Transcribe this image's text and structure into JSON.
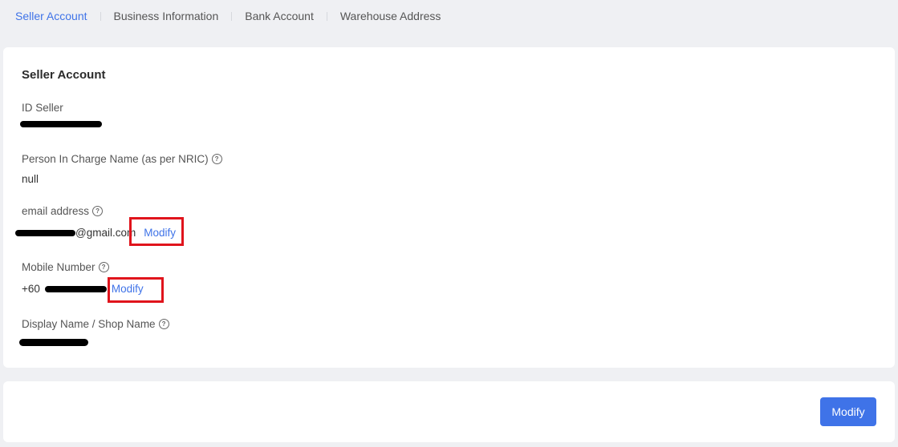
{
  "tabs": [
    {
      "label": "Seller Account",
      "active": true
    },
    {
      "label": "Business Information",
      "active": false
    },
    {
      "label": "Bank Account",
      "active": false
    },
    {
      "label": "Warehouse Address",
      "active": false
    }
  ],
  "section": {
    "title": "Seller Account",
    "id_seller": {
      "label": "ID Seller"
    },
    "pic_name": {
      "label": "Person In Charge Name (as per NRIC)",
      "value": "null"
    },
    "email": {
      "label": "email address",
      "value_suffix": "@gmail.com",
      "modify_label": "Modify"
    },
    "mobile": {
      "label": "Mobile Number",
      "prefix": "+60",
      "modify_label": "Modify"
    },
    "display_name": {
      "label": "Display Name / Shop Name"
    }
  },
  "footer": {
    "modify_button": "Modify"
  },
  "icons": {
    "help": "question-circle-icon"
  },
  "colors": {
    "accent": "#3f73e8",
    "highlight": "#e0141c",
    "background": "#eff0f3"
  }
}
